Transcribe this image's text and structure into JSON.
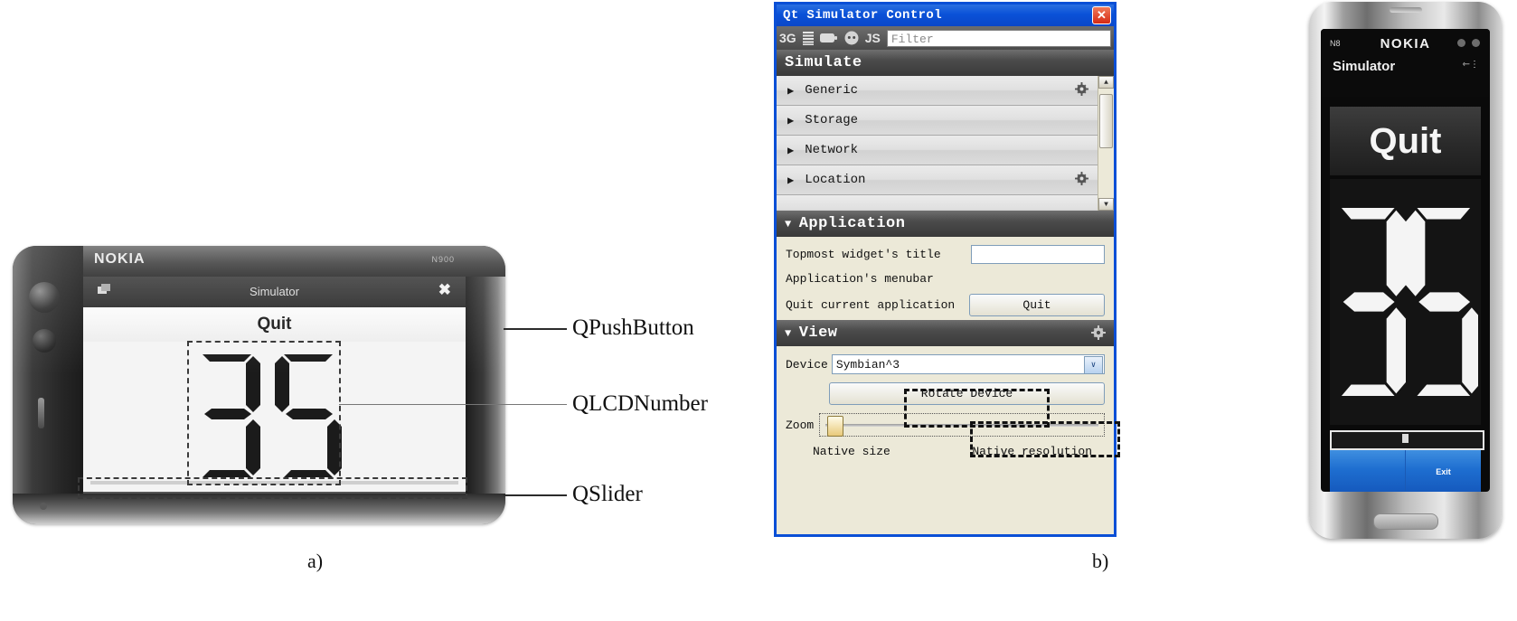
{
  "figure": {
    "caption_a": "a)",
    "caption_b": "b)"
  },
  "figure_a": {
    "device": {
      "brand": "NOKIA",
      "model": "N900"
    },
    "app": {
      "titlebar_title": "Simulator",
      "task_icon": "task-switcher-icon",
      "close_icon": "✖",
      "push_button_label": "Quit",
      "lcd_value": "35",
      "slider_name": "QSlider"
    },
    "annotations": [
      {
        "label": "QPushButton"
      },
      {
        "label": "QLCDNumber"
      },
      {
        "label": "QSlider"
      }
    ]
  },
  "qt_window": {
    "title": "Qt Simulator Control",
    "close_label": "✕",
    "toolbar": {
      "network_label": "3G",
      "signal_icon": "signal-bars-icon",
      "battery_icon": "battery-icon",
      "socket_icon": "power-socket-icon",
      "js_label": "JS",
      "filter_placeholder": "Filter"
    },
    "simulate": {
      "header": "Simulate",
      "collapse_triangle": "▶",
      "rows": [
        {
          "label": "Generic",
          "has_gear": true
        },
        {
          "label": "Storage",
          "has_gear": false
        },
        {
          "label": "Network",
          "has_gear": false
        },
        {
          "label": "Location",
          "has_gear": true
        }
      ],
      "scroll_up": "▲",
      "scroll_down": "▼"
    },
    "application": {
      "header": "Application",
      "expand_triangle": "▼",
      "topmost_title_label": "Topmost widget's title",
      "topmost_title_value": "",
      "menubar_label": "Application's menubar",
      "quit_label": "Quit current application",
      "quit_button": "Quit"
    },
    "view": {
      "header": "View",
      "expand_triangle": "▼",
      "device_label": "Device",
      "device_value": "Symbian^3",
      "device_arrow": "∨",
      "rotate_button": "Rotate Device",
      "zoom_label": "Zoom",
      "native_size": "Native size",
      "native_resolution": "Native resolution"
    }
  },
  "figure_b_device": {
    "brand": "NOKIA",
    "model": "N8",
    "app_title": "Simulator",
    "usb_icon": "usb-icon",
    "quit_button": "Quit",
    "lcd_value": "35",
    "softkey_left": "",
    "softkey_right": "Exit"
  },
  "colors": {
    "title_blue": "#0a4fd6",
    "panel_beige": "#ece9d8",
    "softkey_blue": "#1e6ed0",
    "close_red": "#d52a14"
  }
}
